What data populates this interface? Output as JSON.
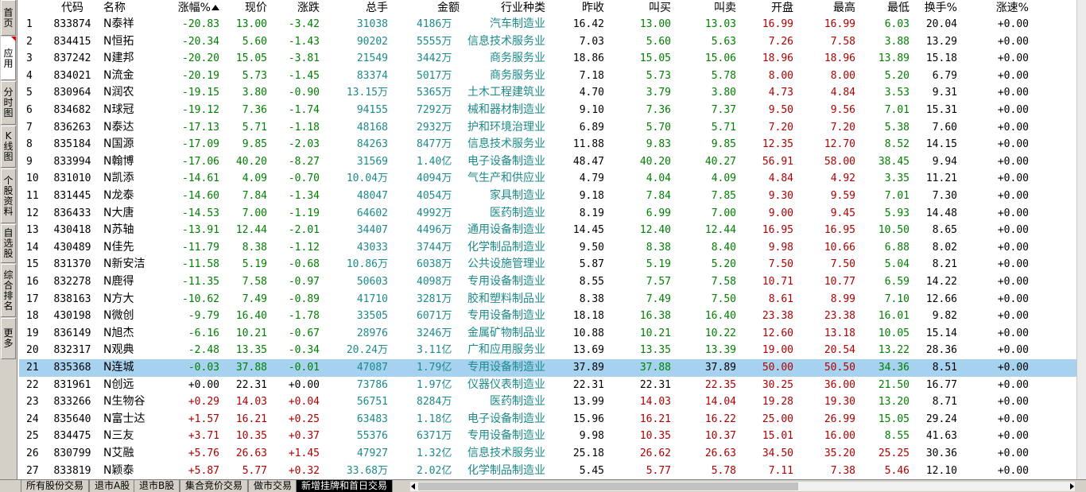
{
  "left_toolbar": [
    {
      "label": "首页",
      "active": false
    },
    {
      "label": "应用",
      "active": true
    },
    {
      "label": "分时图",
      "active": false
    },
    {
      "label": "K线图",
      "active": false
    },
    {
      "label": "个股资料",
      "active": false
    },
    {
      "label": "自选股",
      "active": false
    },
    {
      "label": "综合排名",
      "active": false
    },
    {
      "label": "更多",
      "active": false
    }
  ],
  "columns": {
    "code": "代码",
    "name": "名称",
    "pct": "涨幅%",
    "price": "现价",
    "chg": "涨跌",
    "vol": "总手",
    "amt": "金额",
    "ind": "行业种类",
    "prev": "昨收",
    "bid": "叫买",
    "ask": "叫卖",
    "open": "开盘",
    "high": "最高",
    "low": "最低",
    "turn": "换手%",
    "spd": "涨速%"
  },
  "sort_icon": "sort-up-arrow-icon",
  "colors": {
    "up": "#b00000",
    "down": "#008000",
    "flat": "#000000",
    "teal": "#1c8a8a",
    "selected_row": "#a6d2f0"
  },
  "selected_row_index": 20,
  "rows": [
    {
      "idx": "1",
      "code": "833874",
      "name": "N泰祥",
      "pct": "-20.83",
      "price": "13.00",
      "chg": "-3.42",
      "vol": "31038",
      "amt": "4186万",
      "ind": "汽车制造业",
      "prev": "16.42",
      "bid": "13.00",
      "ask": "13.03",
      "open": "16.99",
      "high": "16.99",
      "low": "6.03",
      "turn": "20.04",
      "spd": "+0.00"
    },
    {
      "idx": "2",
      "code": "834415",
      "name": "N恒拓",
      "pct": "-20.34",
      "price": "5.60",
      "chg": "-1.43",
      "vol": "90202",
      "amt": "5555万",
      "ind": "信息技术服务业",
      "prev": "7.03",
      "bid": "5.60",
      "ask": "5.63",
      "open": "7.26",
      "high": "7.58",
      "low": "3.88",
      "turn": "13.29",
      "spd": "+0.00"
    },
    {
      "idx": "3",
      "code": "837242",
      "name": "N建邦",
      "pct": "-20.20",
      "price": "15.05",
      "chg": "-3.81",
      "vol": "21549",
      "amt": "3442万",
      "ind": "商务服务业",
      "prev": "18.86",
      "bid": "15.05",
      "ask": "15.06",
      "open": "18.96",
      "high": "18.96",
      "low": "13.89",
      "turn": "15.18",
      "spd": "+0.00"
    },
    {
      "idx": "4",
      "code": "834021",
      "name": "N流金",
      "pct": "-20.19",
      "price": "5.73",
      "chg": "-1.45",
      "vol": "83374",
      "amt": "5017万",
      "ind": "商务服务业",
      "prev": "7.18",
      "bid": "5.73",
      "ask": "5.78",
      "open": "8.00",
      "high": "8.00",
      "low": "5.20",
      "turn": "6.79",
      "spd": "+0.00"
    },
    {
      "idx": "5",
      "code": "830964",
      "name": "N润农",
      "pct": "-19.15",
      "price": "3.80",
      "chg": "-0.90",
      "vol": "13.15万",
      "amt": "5365万",
      "ind": "土木工程建筑业",
      "prev": "4.70",
      "bid": "3.79",
      "ask": "3.80",
      "open": "4.73",
      "high": "4.84",
      "low": "3.53",
      "turn": "9.31",
      "spd": "+0.00"
    },
    {
      "idx": "6",
      "code": "834682",
      "name": "N球冠",
      "pct": "-19.12",
      "price": "7.36",
      "chg": "-1.74",
      "vol": "94155",
      "amt": "7292万",
      "ind": "械和器材制造业",
      "prev": "9.10",
      "bid": "7.36",
      "ask": "7.37",
      "open": "9.50",
      "high": "9.56",
      "low": "7.01",
      "turn": "15.31",
      "spd": "+0.00"
    },
    {
      "idx": "7",
      "code": "836263",
      "name": "N泰达",
      "pct": "-17.13",
      "price": "5.71",
      "chg": "-1.18",
      "vol": "48168",
      "amt": "2932万",
      "ind": "护和环境治理业",
      "prev": "6.89",
      "bid": "5.70",
      "ask": "5.71",
      "open": "7.20",
      "high": "7.20",
      "low": "5.38",
      "turn": "7.60",
      "spd": "+0.00"
    },
    {
      "idx": "8",
      "code": "835184",
      "name": "N国源",
      "pct": "-17.09",
      "price": "9.85",
      "chg": "-2.03",
      "vol": "84263",
      "amt": "8477万",
      "ind": "信息技术服务业",
      "prev": "11.88",
      "bid": "9.83",
      "ask": "9.85",
      "open": "12.35",
      "high": "12.70",
      "low": "8.52",
      "turn": "14.15",
      "spd": "+0.00"
    },
    {
      "idx": "9",
      "code": "833994",
      "name": "N翰博",
      "pct": "-17.06",
      "price": "40.20",
      "chg": "-8.27",
      "vol": "31569",
      "amt": "1.40亿",
      "ind": "电子设备制造业",
      "prev": "48.47",
      "bid": "40.20",
      "ask": "40.27",
      "open": "56.91",
      "high": "58.00",
      "low": "38.45",
      "turn": "9.94",
      "spd": "+0.00"
    },
    {
      "idx": "10",
      "code": "831010",
      "name": "N凯添",
      "pct": "-14.61",
      "price": "4.09",
      "chg": "-0.70",
      "vol": "10.04万",
      "amt": "4094万",
      "ind": "气生产和供应业",
      "prev": "4.79",
      "bid": "4.04",
      "ask": "4.09",
      "open": "4.84",
      "high": "4.92",
      "low": "3.35",
      "turn": "11.21",
      "spd": "+0.00"
    },
    {
      "idx": "11",
      "code": "831445",
      "name": "N龙泰",
      "pct": "-14.60",
      "price": "7.84",
      "chg": "-1.34",
      "vol": "48047",
      "amt": "4054万",
      "ind": "家具制造业",
      "prev": "9.18",
      "bid": "7.84",
      "ask": "7.85",
      "open": "9.30",
      "high": "9.59",
      "low": "7.01",
      "turn": "7.30",
      "spd": "+0.00"
    },
    {
      "idx": "12",
      "code": "836433",
      "name": "N大唐",
      "pct": "-14.53",
      "price": "7.00",
      "chg": "-1.19",
      "vol": "64602",
      "amt": "4992万",
      "ind": "医药制造业",
      "prev": "8.19",
      "bid": "6.99",
      "ask": "7.00",
      "open": "9.00",
      "high": "9.45",
      "low": "5.93",
      "turn": "14.48",
      "spd": "+0.00"
    },
    {
      "idx": "13",
      "code": "430418",
      "name": "N苏轴",
      "pct": "-13.91",
      "price": "12.44",
      "chg": "-2.01",
      "vol": "34407",
      "amt": "4496万",
      "ind": "通用设备制造业",
      "prev": "14.45",
      "bid": "12.40",
      "ask": "12.44",
      "open": "16.95",
      "high": "16.95",
      "low": "10.50",
      "turn": "8.65",
      "spd": "+0.00"
    },
    {
      "idx": "14",
      "code": "430489",
      "name": "N佳先",
      "pct": "-11.79",
      "price": "8.38",
      "chg": "-1.12",
      "vol": "43033",
      "amt": "3744万",
      "ind": "化学制品制造业",
      "prev": "9.50",
      "bid": "8.38",
      "ask": "8.40",
      "open": "9.98",
      "high": "10.66",
      "low": "6.88",
      "turn": "8.02",
      "spd": "+0.00"
    },
    {
      "idx": "15",
      "code": "831370",
      "name": "N新安洁",
      "pct": "-11.58",
      "price": "5.19",
      "chg": "-0.68",
      "vol": "10.86万",
      "amt": "6038万",
      "ind": "公共设施管理业",
      "prev": "5.87",
      "bid": "5.19",
      "ask": "5.20",
      "open": "7.50",
      "high": "7.50",
      "low": "5.04",
      "turn": "8.21",
      "spd": "+0.00"
    },
    {
      "idx": "16",
      "code": "832278",
      "name": "N鹿得",
      "pct": "-11.35",
      "price": "7.58",
      "chg": "-0.97",
      "vol": "50603",
      "amt": "4098万",
      "ind": "专用设备制造业",
      "prev": "8.55",
      "bid": "7.57",
      "ask": "7.58",
      "open": "10.71",
      "high": "10.77",
      "low": "6.59",
      "turn": "14.22",
      "spd": "+0.00"
    },
    {
      "idx": "17",
      "code": "838163",
      "name": "N方大",
      "pct": "-10.62",
      "price": "7.49",
      "chg": "-0.89",
      "vol": "41710",
      "amt": "3281万",
      "ind": "胶和塑料制品业",
      "prev": "8.38",
      "bid": "7.49",
      "ask": "7.50",
      "open": "8.61",
      "high": "8.99",
      "low": "7.10",
      "turn": "12.66",
      "spd": "+0.00"
    },
    {
      "idx": "18",
      "code": "430198",
      "name": "N微创",
      "pct": "-9.79",
      "price": "16.40",
      "chg": "-1.78",
      "vol": "33505",
      "amt": "6071万",
      "ind": "专用设备制造业",
      "prev": "18.18",
      "bid": "16.38",
      "ask": "16.40",
      "open": "23.38",
      "high": "23.38",
      "low": "16.01",
      "turn": "9.82",
      "spd": "+0.00"
    },
    {
      "idx": "19",
      "code": "836149",
      "name": "N旭杰",
      "pct": "-6.16",
      "price": "10.21",
      "chg": "-0.67",
      "vol": "28976",
      "amt": "3246万",
      "ind": "金属矿物制品业",
      "prev": "10.88",
      "bid": "10.21",
      "ask": "10.22",
      "open": "12.60",
      "high": "13.18",
      "low": "10.05",
      "turn": "15.14",
      "spd": "+0.00"
    },
    {
      "idx": "20",
      "code": "832317",
      "name": "N观典",
      "pct": "-2.48",
      "price": "13.35",
      "chg": "-0.34",
      "vol": "20.24万",
      "amt": "3.11亿",
      "ind": "广和应用服务业",
      "prev": "13.69",
      "bid": "13.35",
      "ask": "13.39",
      "open": "19.00",
      "high": "20.54",
      "low": "13.22",
      "turn": "28.36",
      "spd": "+0.00"
    },
    {
      "idx": "21",
      "code": "835368",
      "name": "N连城",
      "pct": "-0.03",
      "price": "37.88",
      "chg": "-0.01",
      "vol": "47087",
      "amt": "1.79亿",
      "ind": "专用设备制造业",
      "prev": "37.89",
      "bid": "37.88",
      "ask": "37.89",
      "open": "50.00",
      "high": "50.50",
      "low": "34.36",
      "turn": "8.51",
      "spd": "+0.00"
    },
    {
      "idx": "22",
      "code": "831961",
      "name": "N创远",
      "pct": "+0.00",
      "price": "22.31",
      "chg": "+0.00",
      "vol": "73786",
      "amt": "1.97亿",
      "ind": "仪器仪表制造业",
      "prev": "22.31",
      "bid": "22.31",
      "ask": "22.35",
      "open": "30.25",
      "high": "36.00",
      "low": "21.50",
      "turn": "16.77",
      "spd": "+0.00"
    },
    {
      "idx": "23",
      "code": "833266",
      "name": "N生物谷",
      "pct": "+0.29",
      "price": "14.03",
      "chg": "+0.04",
      "vol": "56751",
      "amt": "8284万",
      "ind": "医药制造业",
      "prev": "13.99",
      "bid": "14.03",
      "ask": "14.04",
      "open": "19.28",
      "high": "19.30",
      "low": "13.20",
      "turn": "8.71",
      "spd": "+0.00"
    },
    {
      "idx": "24",
      "code": "835640",
      "name": "N富士达",
      "pct": "+1.57",
      "price": "16.21",
      "chg": "+0.25",
      "vol": "63483",
      "amt": "1.18亿",
      "ind": "电子设备制造业",
      "prev": "15.96",
      "bid": "16.21",
      "ask": "16.22",
      "open": "25.00",
      "high": "26.99",
      "low": "15.05",
      "turn": "29.24",
      "spd": "+0.00"
    },
    {
      "idx": "25",
      "code": "834475",
      "name": "N三友",
      "pct": "+3.71",
      "price": "10.35",
      "chg": "+0.37",
      "vol": "55376",
      "amt": "6371万",
      "ind": "专用设备制造业",
      "prev": "9.98",
      "bid": "10.35",
      "ask": "10.37",
      "open": "15.01",
      "high": "16.00",
      "low": "8.55",
      "turn": "41.63",
      "spd": "+0.00"
    },
    {
      "idx": "26",
      "code": "830799",
      "name": "N艾融",
      "pct": "+5.76",
      "price": "26.63",
      "chg": "+1.45",
      "vol": "47927",
      "amt": "1.32亿",
      "ind": "信息技术服务业",
      "prev": "25.18",
      "bid": "26.62",
      "ask": "26.63",
      "open": "34.50",
      "high": "35.20",
      "low": "25.25",
      "turn": "30.36",
      "spd": "+0.00"
    },
    {
      "idx": "27",
      "code": "833819",
      "name": "N颖泰",
      "pct": "+5.87",
      "price": "5.77",
      "chg": "+0.32",
      "vol": "33.68万",
      "amt": "2.02亿",
      "ind": "化学制品制造业",
      "prev": "5.45",
      "bid": "5.77",
      "ask": "5.78",
      "open": "7.11",
      "high": "7.38",
      "low": "5.46",
      "turn": "12.10",
      "spd": "+0.00"
    }
  ],
  "bottom_tabs": [
    {
      "label": "所有股份交易",
      "active": false
    },
    {
      "label": "退市A股",
      "active": false
    },
    {
      "label": "退市B股",
      "active": false
    },
    {
      "label": "集合竞价交易",
      "active": false
    },
    {
      "label": "做市交易",
      "active": false
    },
    {
      "label": "新增挂牌和首日交易",
      "active": true
    }
  ]
}
